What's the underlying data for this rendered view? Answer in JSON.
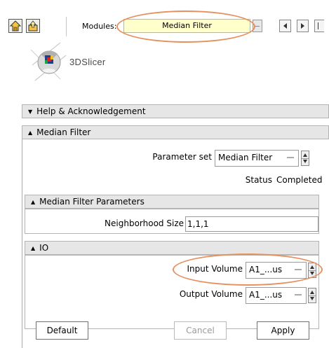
{
  "toolbar": {
    "modules_label": "Modules:",
    "module_selected": "Median Filter"
  },
  "logo": {
    "text": "3DSlicer"
  },
  "sections": {
    "help": {
      "title": "Help & Acknowledgement"
    },
    "module": {
      "title": "Median Filter"
    },
    "params": {
      "title": "Median Filter Parameters"
    },
    "io": {
      "title": "IO"
    }
  },
  "parameter_set": {
    "label": "Parameter set",
    "value": "Median Filter"
  },
  "status": {
    "label": "Status",
    "value": "Completed"
  },
  "neighborhood": {
    "label": "Neighborhood Size",
    "value": "1,1,1"
  },
  "input_volume": {
    "label": "Input Volume",
    "value": "A1_...us"
  },
  "output_volume": {
    "label": "Output Volume",
    "value": "A1_...us"
  },
  "buttons": {
    "default": "Default",
    "cancel": "Cancel",
    "apply": "Apply"
  },
  "colors": {
    "highlight_ellipse": "#e6905e",
    "module_combo_bg": "#ffffcc",
    "header_bg": "#e6e6e6"
  },
  "icons": [
    "home-icon",
    "upload-icon",
    "dropdown-icon",
    "prev-arrow-icon",
    "next-arrow-icon",
    "slicer-logo-icon"
  ]
}
